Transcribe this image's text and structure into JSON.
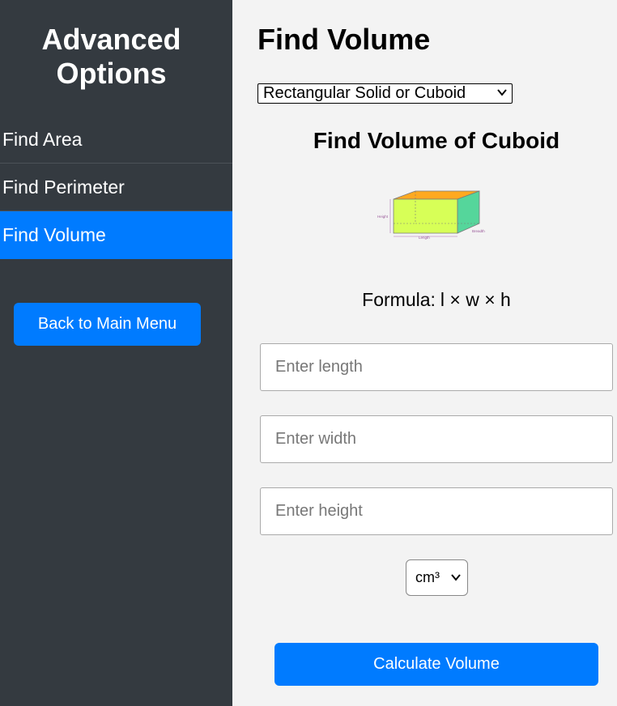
{
  "sidebar": {
    "title": "Advanced Options",
    "items": [
      {
        "label": "Find Area"
      },
      {
        "label": "Find Perimeter"
      },
      {
        "label": "Find Volume"
      }
    ],
    "back_label": "Back to Main Menu"
  },
  "main": {
    "title": "Find Volume",
    "shape_select": {
      "value": "Rectangular Solid or Cuboid"
    },
    "subtitle": "Find Volume of Cuboid",
    "diagram_labels": {
      "height": "Height",
      "length": "Length",
      "breadth": "Breadth"
    },
    "formula": {
      "label": "Formula:",
      "expr": "l × w × h"
    },
    "inputs": {
      "length_placeholder": "Enter length",
      "width_placeholder": "Enter width",
      "height_placeholder": "Enter height"
    },
    "unit_select": {
      "value": "cm³"
    },
    "calc_label": "Calculate Volume"
  },
  "colors": {
    "sidebar_bg": "#343a40",
    "accent": "#007bff",
    "main_bg": "#f3f3f3"
  }
}
